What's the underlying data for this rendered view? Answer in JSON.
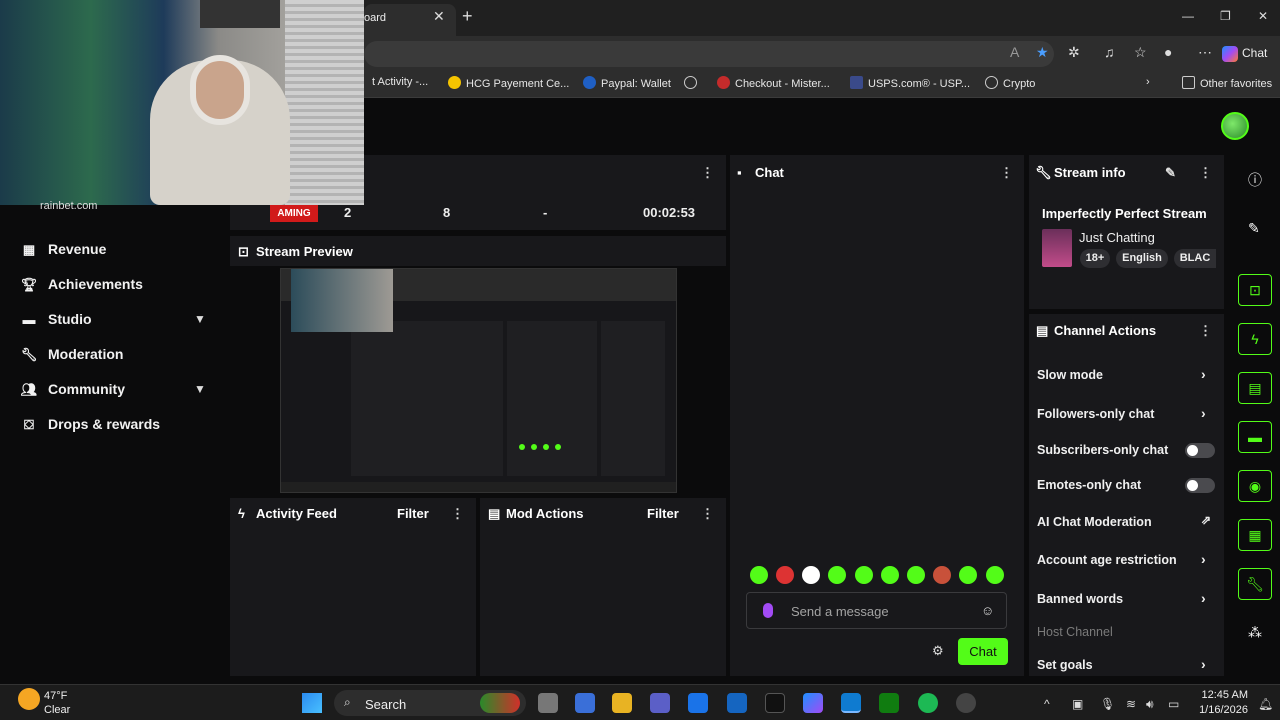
{
  "browser": {
    "tab_title": "oard",
    "close_glyph": "✕",
    "newtab_glyph": "+",
    "copilot_label": "Chat",
    "favorites": [
      "t Activity -...",
      "HCG Payement Ce...",
      "Paypal: Wallet",
      "Checkout - Mister...",
      "USPS.com® - USP...",
      "Crypto"
    ],
    "other_favorites": "Other favorites"
  },
  "webcam": {
    "overlay_text": "rainbet.com"
  },
  "nav": {
    "items": [
      {
        "label": "Revenue",
        "icon": "revenue-icon"
      },
      {
        "label": "Achievements",
        "icon": "trophy-icon"
      },
      {
        "label": "Studio",
        "icon": "studio-icon"
      },
      {
        "label": "Moderation",
        "icon": "wrench-icon"
      },
      {
        "label": "Community",
        "icon": "community-icon"
      },
      {
        "label": "Drops & rewards",
        "icon": "gift-icon"
      }
    ]
  },
  "stats": {
    "status": "AMING",
    "viewers": "2",
    "followers": "8",
    "subs": "-",
    "uptime": "00:02:53"
  },
  "preview": {
    "title": "Stream Preview"
  },
  "activity": {
    "title": "Activity Feed",
    "filter": "Filter"
  },
  "mod_actions": {
    "title": "Mod Actions",
    "filter": "Filter"
  },
  "chat": {
    "title": "Chat",
    "placeholder": "Send a message",
    "send_label": "Chat"
  },
  "stream_info": {
    "title": "Stream info",
    "stream_title": "Imperfectly Perfect Stream",
    "category": "Just Chatting",
    "tags": [
      "18+",
      "English",
      "BLAC"
    ]
  },
  "channel_actions": {
    "title": "Channel Actions",
    "items": {
      "slow_mode": "Slow mode",
      "followers_only": "Followers-only chat",
      "subscribers_only": "Subscribers-only chat",
      "emotes_only": "Emotes-only chat",
      "ai_moderation": "AI Chat Moderation",
      "account_age": "Account age restriction",
      "banned_words": "Banned words",
      "host_channel": "Host Channel",
      "set_goals": "Set goals"
    }
  },
  "taskbar": {
    "temperature": "47°F",
    "condition": "Clear",
    "search_label": "Search",
    "time": "12:45 AM",
    "date": "1/16/2026"
  },
  "colors": {
    "accent": "#53fc18",
    "live_red": "#d11a1a",
    "panel": "#18181b"
  }
}
